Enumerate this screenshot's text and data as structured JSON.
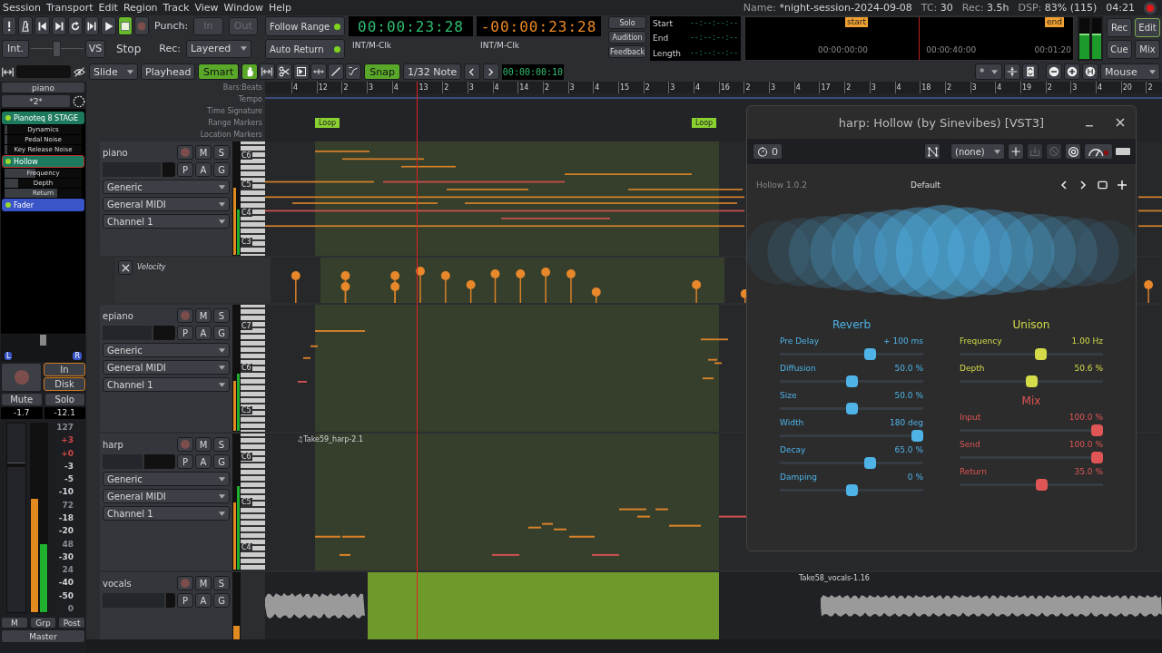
{
  "menu": [
    "Session",
    "Transport",
    "Edit",
    "Region",
    "Track",
    "View",
    "Window",
    "Help"
  ],
  "status": [
    {
      "label": "Name:",
      "value": "*night-session-2024-09-08"
    },
    {
      "label": "TC:",
      "value": "30"
    },
    {
      "label": "Rec:",
      "value": "3.5h"
    },
    {
      "label": "DSP:",
      "value": "83% (115)"
    }
  ],
  "clock": "04:21",
  "transport": {
    "buttons": [
      {
        "kind": "alert",
        "selected": false
      },
      {
        "kind": "metronome",
        "selected": false
      },
      {
        "kind": "start",
        "selected": false
      },
      {
        "kind": "end",
        "selected": false
      },
      {
        "kind": "loop",
        "selected": false
      },
      {
        "kind": "range",
        "selected": false
      },
      {
        "kind": "play",
        "selected": false
      },
      {
        "kind": "stop",
        "selected": true
      },
      {
        "kind": "record",
        "selected": false
      }
    ],
    "punch_label": "Punch:",
    "punch": [
      {
        "label": "In",
        "disabled": true
      },
      {
        "label": "Out",
        "disabled": true
      }
    ],
    "sync": "Int.",
    "shuttle": {
      "level": 0.5
    },
    "vs": "VS",
    "state": "Stop",
    "rec_label": "Rec:",
    "rec_mode": "Layered"
  },
  "options": [
    {
      "label": "Follow Range",
      "on": true
    },
    {
      "label": "Auto Return",
      "on": true
    }
  ],
  "clocks": [
    {
      "kind": "primary",
      "time": "00:00:23:28",
      "source": "INT/M-Clk"
    },
    {
      "kind": "secondary",
      "time": "-00:00:23:28",
      "source": "INT/M-Clk"
    }
  ],
  "monitor_buttons": [
    "Solo",
    "Audition",
    "Feedback"
  ],
  "range_info": [
    {
      "label": "Start",
      "value": "--:--:--:--"
    },
    {
      "label": "End",
      "value": "--:--:--:--"
    },
    {
      "label": "Length",
      "value": "--:--:--:--"
    }
  ],
  "mini_timeline": {
    "markers": [
      "start",
      "end"
    ],
    "times": [
      "00:00:00:00",
      "00:00:40:00",
      "00:01:20"
    ]
  },
  "master_meters": [
    {
      "level": 0.62
    },
    {
      "level": 0.62
    }
  ],
  "window_buttons": [
    {
      "label": "Rec",
      "selected": false
    },
    {
      "label": "Edit",
      "selected": true
    },
    {
      "label": "Cue",
      "selected": false
    },
    {
      "label": "Mix",
      "selected": false
    }
  ],
  "edit_toolbar": {
    "edit_mode": "Slide",
    "edit_point": "Playhead",
    "smart": {
      "label": "Smart",
      "on": true
    },
    "tools": [
      {
        "kind": "grab",
        "selected": true
      },
      {
        "kind": "range",
        "selected": false
      },
      {
        "kind": "cut",
        "selected": false
      },
      {
        "kind": "content",
        "selected": false
      },
      {
        "kind": "move",
        "selected": false
      },
      {
        "kind": "draw",
        "selected": false
      },
      {
        "kind": "internal",
        "selected": false
      }
    ],
    "snap": {
      "label": "Snap",
      "on": true
    },
    "grid": "1/32 Note",
    "nudge": "00:00:00:10",
    "zoom_focus": "*",
    "mouse": "Mouse"
  },
  "strip": {
    "name": "piano",
    "input": "*2*",
    "processors": [
      {
        "name": "Pianoteq 8 STAGE",
        "color": "#1e7a5e",
        "selected": false,
        "params": [
          {
            "name": "Dynamics",
            "level": 0.03
          },
          {
            "name": "Pedal Noise",
            "level": 0.03
          },
          {
            "name": "Key Release Noise",
            "level": 0.03
          }
        ]
      },
      {
        "name": "Hollow",
        "color": "#1e7a5e",
        "selected": true,
        "params": [
          {
            "name": "Frequency",
            "level": 0.4
          },
          {
            "name": "Depth",
            "level": 0.18
          },
          {
            "name": "Return",
            "level": 0.68
          }
        ]
      },
      {
        "name": "Fader",
        "color": "#3a55c8",
        "selected": false
      }
    ],
    "panner": {
      "left": "L",
      "right": "R",
      "level": 0.5
    },
    "monitor": [
      {
        "label": "In",
        "on": true
      },
      {
        "label": "Disk",
        "on": true
      }
    ],
    "mute": "Mute",
    "solo": "Solo",
    "gain": "-1.7",
    "peak": "-12.1",
    "fader": {
      "level": 0.77
    },
    "meters": [
      {
        "level": 0.6
      },
      {
        "level": 0.36
      }
    ],
    "scale": [
      {
        "label": "127",
        "color": "#8a8d92"
      },
      {
        "label": "+3",
        "color": "#d04848"
      },
      {
        "label": "+0",
        "color": "#d04848"
      },
      {
        "label": "-3",
        "color": "#d0d2d6"
      },
      {
        "label": "-5",
        "color": "#d0d2d6"
      },
      {
        "label": "-10",
        "color": "#d0d2d6"
      },
      {
        "label": "72",
        "color": "#8a8d92"
      },
      {
        "label": "-18",
        "color": "#d0d2d6"
      },
      {
        "label": "-20",
        "color": "#d0d2d6"
      },
      {
        "label": "48",
        "color": "#8a8d92"
      },
      {
        "label": "-30",
        "color": "#d0d2d6"
      },
      {
        "label": "24",
        "color": "#8a8d92"
      },
      {
        "label": "-40",
        "color": "#d0d2d6"
      },
      {
        "label": "-50",
        "color": "#d0d2d6"
      },
      {
        "label": "0",
        "color": "#8a8d92"
      }
    ],
    "bottom": [
      "M",
      "Grp",
      "Post"
    ],
    "bus": "Master"
  },
  "rulers": {
    "labels": [
      "Bars:Beats",
      "Tempo",
      "Time Signature",
      "Range Markers",
      "Location Markers"
    ],
    "bars": [
      "4",
      "12",
      "2",
      "3",
      "4",
      "13",
      "2",
      "3",
      "4",
      "14",
      "2",
      "3",
      "4",
      "15",
      "2",
      "3",
      "4",
      "16",
      "2",
      "3",
      "4",
      "17",
      "2",
      "3",
      "4",
      "18",
      "2",
      "3",
      "4",
      "19",
      "2",
      "3",
      "4",
      "20",
      "2"
    ],
    "loops": [
      "Loop",
      "Loop"
    ]
  },
  "tracks": [
    {
      "name": "piano",
      "kind": "midi",
      "top_buttons": [
        "M",
        "S"
      ],
      "bottom_buttons": [
        "P",
        "A",
        "G"
      ],
      "fader": {
        "level": 0.8
      },
      "selects": [
        "Generic",
        "General MIDI",
        "Channel 1"
      ],
      "keys": [
        "C6",
        "C5",
        "C4",
        "C3"
      ],
      "meters": [
        {
          "level": 0.6
        },
        {
          "level": 0.4
        }
      ],
      "lane": {
        "label": "Velocity"
      }
    },
    {
      "name": "epiano",
      "kind": "midi",
      "top_buttons": [
        "M",
        "S"
      ],
      "bottom_buttons": [
        "P",
        "A",
        "G"
      ],
      "fader": {
        "level": 0.68
      },
      "selects": [
        "Generic",
        "General MIDI",
        "Channel 1"
      ],
      "keys": [
        "C7",
        "C6",
        "C5"
      ],
      "meters": [
        {
          "level": 0.4
        },
        {
          "level": 0.46
        }
      ]
    },
    {
      "name": "harp",
      "kind": "midi",
      "top_buttons": [
        "M",
        "S"
      ],
      "bottom_buttons": [
        "P",
        "A",
        "G"
      ],
      "fader": {
        "level": 0.55
      },
      "selects": [
        "Generic",
        "General MIDI",
        "Channel 1"
      ],
      "keys": [
        "C6",
        "C5",
        "C4"
      ],
      "meters": [
        {
          "level": 0.5
        },
        {
          "level": 0.62
        }
      ],
      "region": "♫Take59_harp-2.1"
    },
    {
      "name": "vocals",
      "kind": "audio",
      "top_buttons": [
        "M",
        "S"
      ],
      "bottom_buttons": [
        "P",
        "A",
        "G"
      ],
      "fader": {
        "level": 0.85
      },
      "meters": [
        {
          "level": 0.2
        }
      ],
      "region": "Take58_vocals-1.16"
    }
  ],
  "plugin": {
    "title": "harp: Hollow (by Sinevibes) [VST3]",
    "latency": "0",
    "preset": "(none)",
    "version": "Hollow 1.0.2",
    "preset_name": "Default",
    "sections": [
      {
        "title": "Reverb",
        "color": "#4fb3e8",
        "params": [
          {
            "name": "Pre Delay",
            "value": "+ 100 ms",
            "level": 0.64
          },
          {
            "name": "Diffusion",
            "value": "50.0 %",
            "level": 0.5
          },
          {
            "name": "Size",
            "value": "50.0 %",
            "level": 0.5
          },
          {
            "name": "Width",
            "value": "180 deg",
            "level": 1
          },
          {
            "name": "Decay",
            "value": "65.0 %",
            "level": 0.64
          },
          {
            "name": "Damping",
            "value": "0 %",
            "level": 0.5
          }
        ]
      },
      {
        "title": "Unison",
        "color": "#d4dc4a",
        "params": [
          {
            "name": "Frequency",
            "value": "1.00 Hz",
            "level": 0.57
          },
          {
            "name": "Depth",
            "value": "50.6 %",
            "level": 0.5
          }
        ]
      },
      {
        "title": "Mix",
        "color": "#e05555",
        "params": [
          {
            "name": "Input",
            "value": "100.0 %",
            "level": 1
          },
          {
            "name": "Send",
            "value": "100.0 %",
            "level": 1
          },
          {
            "name": "Return",
            "value": "35.0 %",
            "level": 0.58
          }
        ]
      }
    ]
  }
}
